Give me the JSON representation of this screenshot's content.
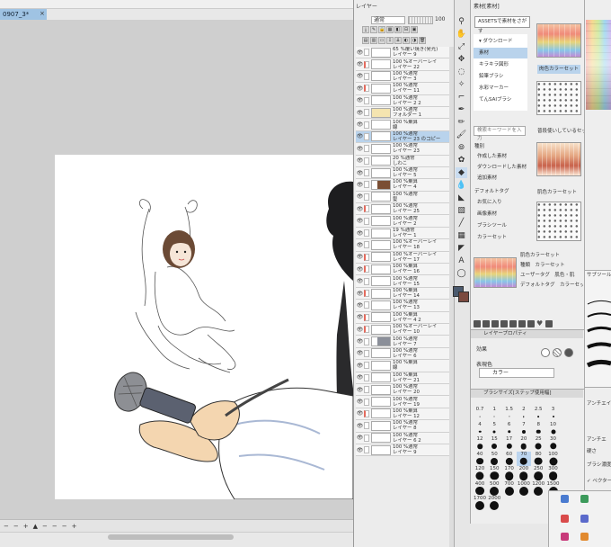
{
  "document": {
    "tab_title": "0907_3*",
    "close": "×"
  },
  "status": {
    "items": [
      "−",
      "−",
      "+",
      "▲",
      "−",
      "−",
      "−",
      "+"
    ]
  },
  "layer_panel": {
    "title": "レイヤー",
    "blend_mode": "通常",
    "opacity": "100",
    "layers": [
      {
        "text": "65 %覆い焼き(発光)\nレイヤー 9",
        "thumb": "white",
        "sel": false,
        "mark": false
      },
      {
        "text": "100 %オーバーレイ\nレイヤー 22",
        "thumb": "white",
        "sel": false,
        "mark": true
      },
      {
        "text": "100 %通常\nレイヤー 3",
        "thumb": "white",
        "sel": false,
        "mark": false
      },
      {
        "text": "100 %通常\nレイヤー 11",
        "thumb": "white",
        "sel": false,
        "mark": true
      },
      {
        "text": "100 %通常\nレイヤー 2 2",
        "thumb": "white",
        "sel": false,
        "mark": false
      },
      {
        "text": "100 %通常\nフォルダー 1",
        "thumb": "folder",
        "sel": false,
        "mark": false
      },
      {
        "text": "100 %乗算\n線",
        "thumb": "white",
        "sel": false,
        "mark": false
      },
      {
        "text": "100 %通常\nレイヤー 23 のコピー",
        "thumb": "white",
        "sel": true,
        "mark": false
      },
      {
        "text": "100 %通常\nレイヤー 23",
        "thumb": "white",
        "sel": false,
        "mark": false
      },
      {
        "text": "20 %通常\nしわこ",
        "thumb": "white",
        "sel": false,
        "mark": false
      },
      {
        "text": "100 %通常\nレイヤー 5",
        "thumb": "white",
        "sel": false,
        "mark": false
      },
      {
        "text": "100 %乗算\nレイヤー 4",
        "thumb": "brown",
        "sel": false,
        "mark": false
      },
      {
        "text": "100 %通常\n髪",
        "thumb": "white",
        "sel": false,
        "mark": false
      },
      {
        "text": "100 %通常\nレイヤー 25",
        "thumb": "white",
        "sel": false,
        "mark": true
      },
      {
        "text": "100 %通常\nレイヤー 2",
        "thumb": "white",
        "sel": false,
        "mark": false
      },
      {
        "text": "19 %通常\nレイヤー 1",
        "thumb": "white",
        "sel": false,
        "mark": false
      },
      {
        "text": "100 %オーバーレイ\nレイヤー 18",
        "thumb": "white",
        "sel": false,
        "mark": false
      },
      {
        "text": "100 %オーバーレイ\nレイヤー 17",
        "thumb": "white",
        "sel": false,
        "mark": true
      },
      {
        "text": "100 %乗算\nレイヤー 16",
        "thumb": "white",
        "sel": false,
        "mark": true
      },
      {
        "text": "100 %通常\nレイヤー 15",
        "thumb": "white",
        "sel": false,
        "mark": false
      },
      {
        "text": "100 %乗算\nレイヤー 14",
        "thumb": "white",
        "sel": false,
        "mark": true
      },
      {
        "text": "100 %通常\nレイヤー 13",
        "thumb": "white",
        "sel": false,
        "mark": false
      },
      {
        "text": "100 %乗算\nレイヤー 4 2",
        "thumb": "white",
        "sel": false,
        "mark": true
      },
      {
        "text": "100 %オーバーレイ\nレイヤー 10",
        "thumb": "white",
        "sel": false,
        "mark": true
      },
      {
        "text": "100 %通常\nレイヤー 7",
        "thumb": "grey",
        "sel": false,
        "mark": false
      },
      {
        "text": "100 %通常\nレイヤー 6",
        "thumb": "white",
        "sel": false,
        "mark": false
      },
      {
        "text": "100 %乗算\n線",
        "thumb": "white",
        "sel": false,
        "mark": false
      },
      {
        "text": "100 %乗算\nレイヤー 21",
        "thumb": "white",
        "sel": false,
        "mark": false
      },
      {
        "text": "100 %通常\nレイヤー 20",
        "thumb": "white",
        "sel": false,
        "mark": false
      },
      {
        "text": "100 %通常\nレイヤー 19",
        "thumb": "white",
        "sel": false,
        "mark": false
      },
      {
        "text": "100 %乗算\nレイヤー 12",
        "thumb": "white",
        "sel": false,
        "mark": true
      },
      {
        "text": "100 %通常\nレイヤー 8",
        "thumb": "white",
        "sel": false,
        "mark": false
      },
      {
        "text": "100 %通常\nレイヤー 6 2",
        "thumb": "white",
        "sel": false,
        "mark": false
      },
      {
        "text": "100 %通常\nレイヤー 9",
        "thumb": "white",
        "sel": false,
        "mark": false
      }
    ]
  },
  "material_panel": {
    "tab": "素材[素材]",
    "assets_button": "ASSETSで素材をさがす",
    "tree": [
      {
        "label": "▾ ダウンロード",
        "sel": false
      },
      {
        "label": "素材",
        "sel": true
      },
      {
        "label": "キラキラ図形",
        "sel": false
      },
      {
        "label": "鉛筆ブラシ",
        "sel": false
      },
      {
        "label": "水彩マーカー",
        "sel": false
      },
      {
        "label": "てんSAIブラシ",
        "sel": false
      }
    ],
    "search_placeholder": "検索キーワードを入力",
    "tags": [
      "種別",
      "作成した素材",
      "ダウンロードした素材",
      "追加素材",
      "デフォルトタグ",
      "お気に入り",
      "画像素材",
      "ブラシツール",
      "カラーセット"
    ],
    "labels": {
      "set1": "肉色カラーセット",
      "set2": "普段使いしているセット",
      "set3": "肌色カラーセット",
      "set4_title": "肌色カラーセット",
      "set4_type": "種類　カラーセット",
      "set4_tag": "デフォルトタグ　カラーセット",
      "set4_extra": "ユーザータグ　肌色・肌"
    }
  },
  "layer_property": {
    "title": "レイヤープロパティ",
    "effect_label": "効果",
    "expression_label": "表現色",
    "expression_value": "カラー"
  },
  "brush_size": {
    "title": "ブラシサイズ[ステップ使用幅]",
    "sizes": [
      {
        "label": "0.7",
        "d": 0.8
      },
      {
        "label": "1",
        "d": 1
      },
      {
        "label": "1.5",
        "d": 1.2
      },
      {
        "label": "2",
        "d": 1.5
      },
      {
        "label": "2.5",
        "d": 1.8
      },
      {
        "label": "3",
        "d": 2
      },
      {
        "label": "4",
        "d": 2.5
      },
      {
        "label": "5",
        "d": 3
      },
      {
        "label": "6",
        "d": 3.5
      },
      {
        "label": "7",
        "d": 4
      },
      {
        "label": "8",
        "d": 4.5
      },
      {
        "label": "10",
        "d": 5
      },
      {
        "label": "12",
        "d": 5.5
      },
      {
        "label": "15",
        "d": 6
      },
      {
        "label": "17",
        "d": 6.3
      },
      {
        "label": "20",
        "d": 6.6
      },
      {
        "label": "25",
        "d": 7
      },
      {
        "label": "30",
        "d": 7.4
      },
      {
        "label": "40",
        "d": 7.8
      },
      {
        "label": "50",
        "d": 8
      },
      {
        "label": "60",
        "d": 8.3
      },
      {
        "label": "70",
        "d": 8.6
      },
      {
        "label": "80",
        "d": 8.8
      },
      {
        "label": "100",
        "d": 9
      },
      {
        "label": "120",
        "d": 9.2
      },
      {
        "label": "150",
        "d": 9.4
      },
      {
        "label": "170",
        "d": 9.5
      },
      {
        "label": "200",
        "d": 9.6
      },
      {
        "label": "250",
        "d": 9.7
      },
      {
        "label": "300",
        "d": 9.8
      },
      {
        "label": "400",
        "d": 9.9
      },
      {
        "label": "500",
        "d": 10
      },
      {
        "label": "700",
        "d": 10
      },
      {
        "label": "1000",
        "d": 10
      },
      {
        "label": "1200",
        "d": 10
      },
      {
        "label": "1500",
        "d": 10
      },
      {
        "label": "1700",
        "d": 10
      },
      {
        "label": "2000",
        "d": 10
      }
    ],
    "selected_index": 21
  },
  "right_column": {
    "tool_sub_label": "アンチエイリアス",
    "labels": [
      "サブツール",
      "アンチエ",
      "硬さ",
      "ブラシ濃度",
      "✓ ベクター"
    ]
  },
  "colors": {
    "selection": "#b9d3ec",
    "canvas_bg": "#cfcfcf",
    "main_color": "#4b5a6e",
    "sub_color": "#7b4a3f"
  }
}
